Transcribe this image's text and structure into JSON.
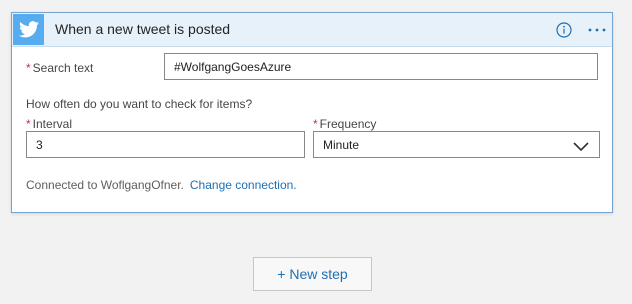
{
  "card": {
    "title": "When a new tweet is posted",
    "icon": "twitter-icon",
    "accent_color": "#55acee",
    "header_bg": "#e7f1fa",
    "border_color": "#74a4cf"
  },
  "fields": {
    "required_marker": "*",
    "search_text": {
      "label": "Search text",
      "value": "#WolfgangGoesAzure"
    },
    "check_question": "How often do you want to check for items?",
    "interval": {
      "label": "Interval",
      "value": "3"
    },
    "frequency": {
      "label": "Frequency",
      "value": "Minute"
    }
  },
  "connection": {
    "text": "Connected to WoflgangOfner.",
    "change_label": "Change connection."
  },
  "new_step": {
    "label": "+ New step"
  }
}
